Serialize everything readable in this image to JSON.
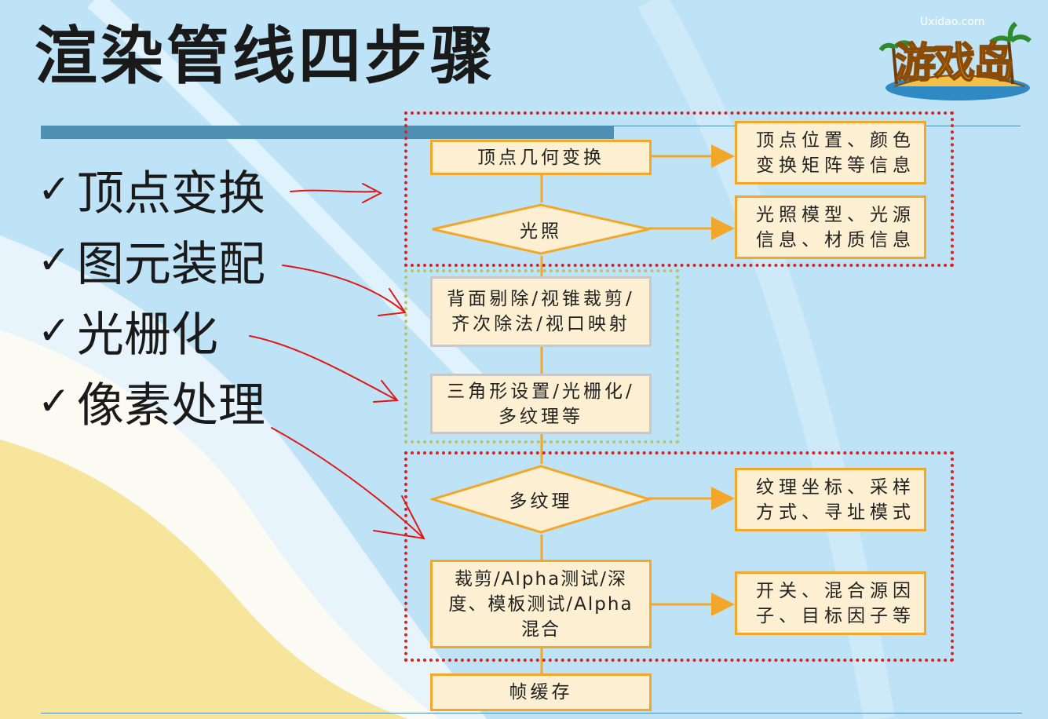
{
  "title": "渲染管线四步骤",
  "steps": [
    {
      "check": "✓",
      "label": "顶点变换"
    },
    {
      "check": "✓",
      "label": "图元装配"
    },
    {
      "check": "✓",
      "label": "光栅化"
    },
    {
      "check": "✓",
      "label": "像素处理"
    }
  ],
  "logo": {
    "url": "Uxidao.com",
    "text": "游戏岛"
  },
  "flow": {
    "vertex_transform": "顶点几何变换",
    "lighting": "光照",
    "cull_clip": "背面剔除/视锥裁剪/\n齐次除法/视口映射",
    "raster_setup": "三角形设置/光栅化/\n多纹理等",
    "multitexture": "多纹理",
    "tests_blend": "裁剪/Alpha测试/深\n度、模板测试/Alpha\n混合",
    "framebuffer": "帧缓存"
  },
  "info": {
    "vertex": "顶点位置、颜色\n变换矩阵等信息",
    "lighting": "光照模型、光源\n信息、材质信息",
    "texture": "纹理坐标、采样\n方式、寻址模式",
    "blend": "开关、混合源因\n子、目标因子等"
  },
  "colors": {
    "box_border": "#f2a72a",
    "box_fill": "#fdf0d2",
    "group_red": "#e02020",
    "group_green": "#b5c36a",
    "annotation": "#e01818",
    "title_bar": "#4f8fb4"
  }
}
